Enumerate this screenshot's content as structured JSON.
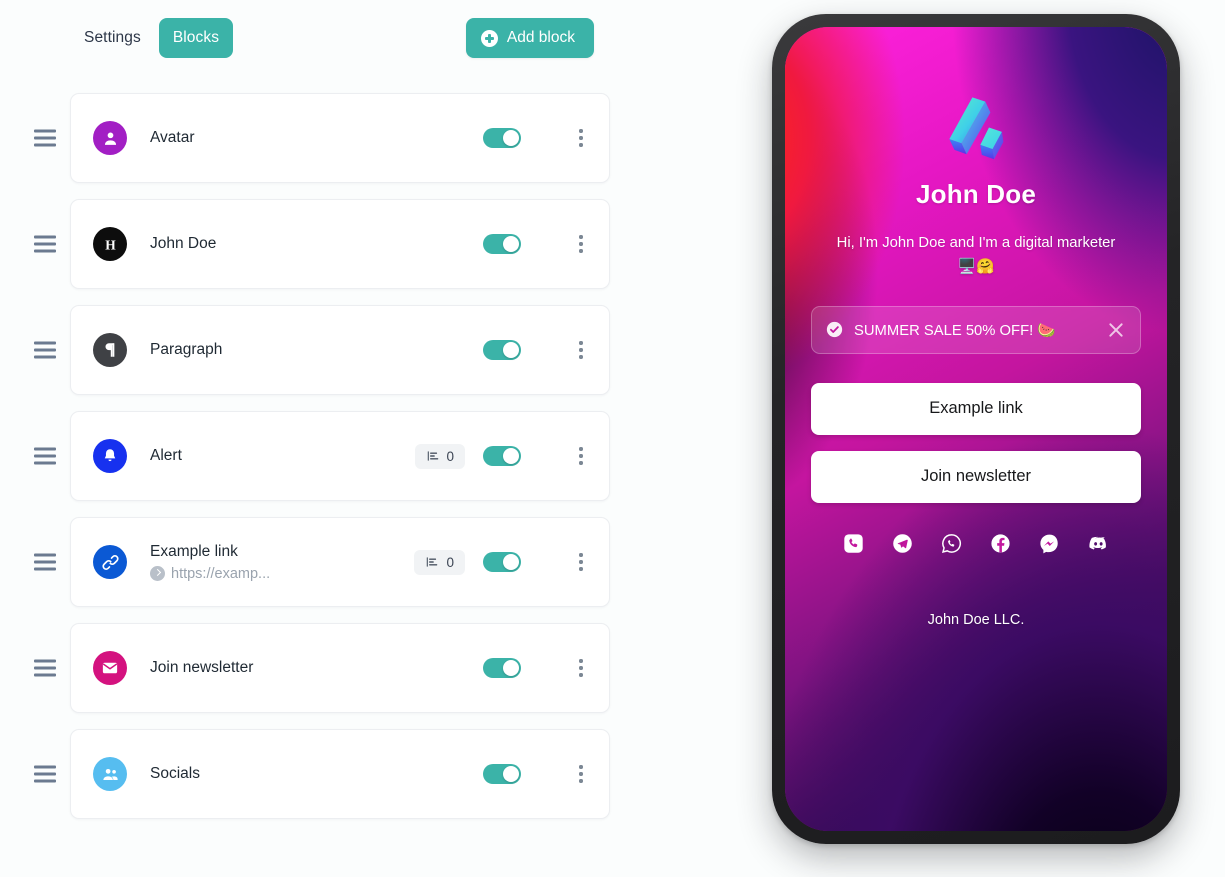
{
  "toolbar": {
    "tabs": [
      {
        "label": "Settings",
        "active": false
      },
      {
        "label": "Blocks",
        "active": true
      }
    ],
    "add_block_label": "Add block",
    "accent_color": "#3bb3a8"
  },
  "blocks": [
    {
      "title": "Avatar",
      "icon": "user-icon",
      "icon_bg": "#a21fc4",
      "subtitle": null,
      "stats": null,
      "enabled": true
    },
    {
      "title": "John Doe",
      "icon": "heading-icon",
      "icon_bg": "#0d0d0d",
      "subtitle": null,
      "stats": null,
      "enabled": true
    },
    {
      "title": "Paragraph",
      "icon": "paragraph-icon",
      "icon_bg": "#3f4145",
      "subtitle": null,
      "stats": null,
      "enabled": true
    },
    {
      "title": "Alert",
      "icon": "bell-icon",
      "icon_bg": "#1731ef",
      "subtitle": null,
      "stats": "0",
      "enabled": true
    },
    {
      "title": "Example link",
      "icon": "link-icon",
      "icon_bg": "#0b59d4",
      "subtitle": "https://examp...",
      "stats": "0",
      "enabled": true
    },
    {
      "title": "Join newsletter",
      "icon": "envelope-icon",
      "icon_bg": "#d4127f",
      "subtitle": null,
      "stats": null,
      "enabled": true
    },
    {
      "title": "Socials",
      "icon": "people-icon",
      "icon_bg": "#56bdf0",
      "subtitle": null,
      "stats": null,
      "enabled": true
    }
  ],
  "preview": {
    "profile_name": "John Doe",
    "bio": "Hi, I'm John Doe and I'm a digital marketer 🖥️🤗",
    "alert": {
      "text": "SUMMER SALE 50% OFF! 🍉",
      "icon": "check-circle-icon",
      "close_icon": "close-icon"
    },
    "links": [
      {
        "label": "Example link"
      },
      {
        "label": "Join newsletter"
      }
    ],
    "socials": [
      {
        "name": "phone-icon"
      },
      {
        "name": "telegram-icon"
      },
      {
        "name": "whatsapp-icon"
      },
      {
        "name": "facebook-icon"
      },
      {
        "name": "messenger-icon"
      },
      {
        "name": "discord-icon"
      }
    ],
    "footer": "John Doe LLC.",
    "background_colors": [
      "#ff22dd",
      "#f0193f",
      "#7d1380",
      "#2b0a4e",
      "#07010f"
    ]
  }
}
